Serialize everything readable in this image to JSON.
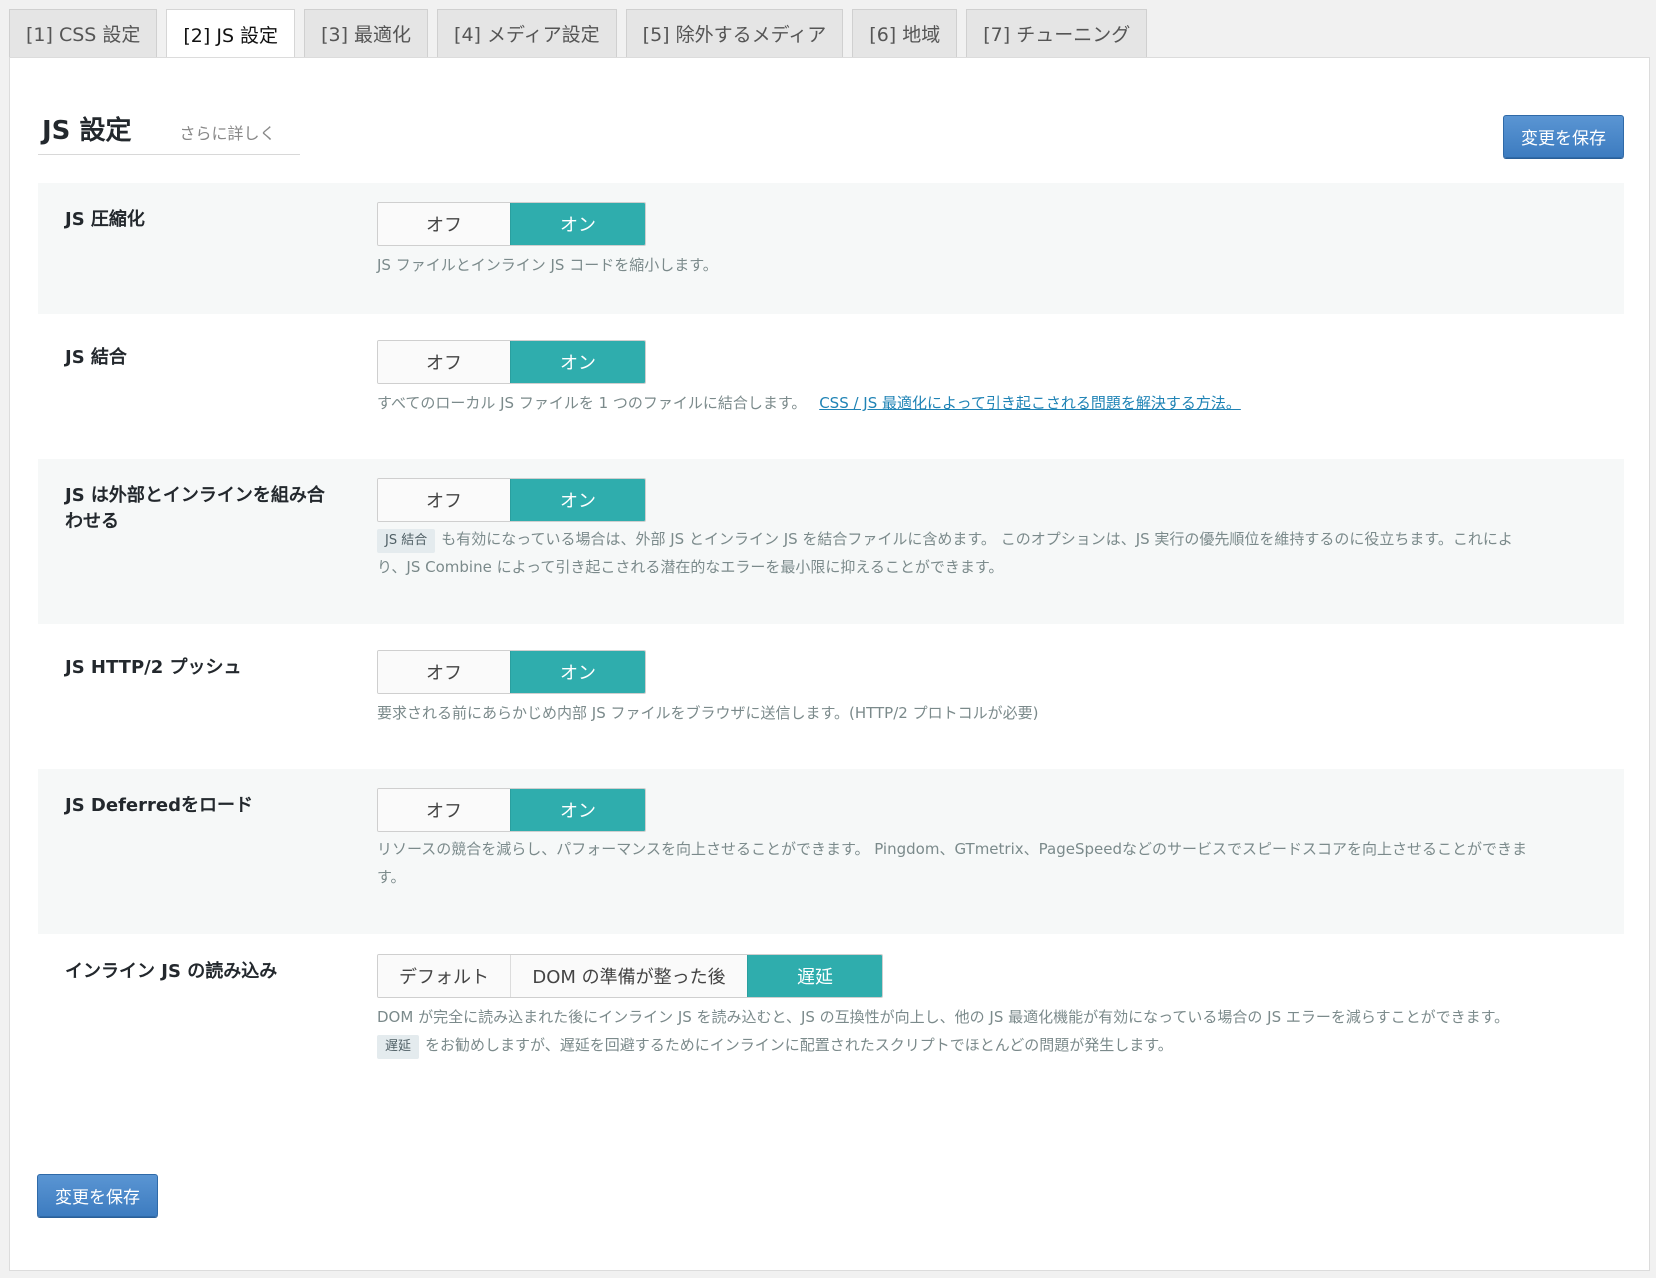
{
  "tabs": [
    {
      "label": "[1] CSS 設定"
    },
    {
      "label": "[2] JS 設定"
    },
    {
      "label": "[3] 最適化"
    },
    {
      "label": "[4] メディア設定"
    },
    {
      "label": "[5] 除外するメディア"
    },
    {
      "label": "[6] 地域"
    },
    {
      "label": "[7] チューニング"
    }
  ],
  "active_tab": 1,
  "page": {
    "title": "JS 設定",
    "learn_more": "さらに詳しく",
    "save_label": "変更を保存"
  },
  "settings": [
    {
      "label": "JS 圧縮化",
      "off": "オフ",
      "on": "オン",
      "value": "on",
      "description": "JS ファイルとインライン JS コードを縮小します。"
    },
    {
      "label": "JS 結合",
      "off": "オフ",
      "on": "オン",
      "value": "on",
      "description": "すべてのローカル JS ファイルを 1 つのファイルに結合します。",
      "link": "CSS / JS 最適化によって引き起こされる問題を解決する方法。"
    },
    {
      "label": "JS は外部とインラインを組み合わせる",
      "off": "オフ",
      "on": "オン",
      "value": "on",
      "code_tag": "JS 結合",
      "description": "も有効になっている場合は、外部 JS とインライン JS を結合ファイルに含めます。 このオプションは、JS 実行の優先順位を維持するのに役立ちます。これにより、JS Combine によって引き起こされる潜在的なエラーを最小限に抑えることができます。"
    },
    {
      "label": "JS HTTP/2 プッシュ",
      "off": "オフ",
      "on": "オン",
      "value": "on",
      "description": "要求される前にあらかじめ内部 JS ファイルをブラウザに送信します。(HTTP/2 プロトコルが必要)"
    },
    {
      "label": "JS Deferredをロード",
      "off": "オフ",
      "on": "オン",
      "value": "on",
      "description": "リソースの競合を減らし、パフォーマンスを向上させることができます。 Pingdom、GTmetrix、PageSpeedなどのサービスでスピードスコアを向上させることができます。"
    },
    {
      "label": "インライン JS の読み込み",
      "options": [
        "デフォルト",
        "DOM の準備が整った後",
        "遅延"
      ],
      "selected": 2,
      "description": "DOM が完全に読み込まれた後にインライン JS を読み込むと、JS の互換性が向上し、他の JS 最適化機能が有効になっている場合の JS エラーを減らすことができます。",
      "code_tag": "遅延",
      "note": "をお勧めしますが、遅延を回避するためにインラインに配置されたスクリプトでほとんどの問題が発生します。"
    }
  ],
  "colors": {
    "toggle_on": "#2fadad",
    "primary_button": "#3d7cc0",
    "link": "#1f83b5"
  }
}
